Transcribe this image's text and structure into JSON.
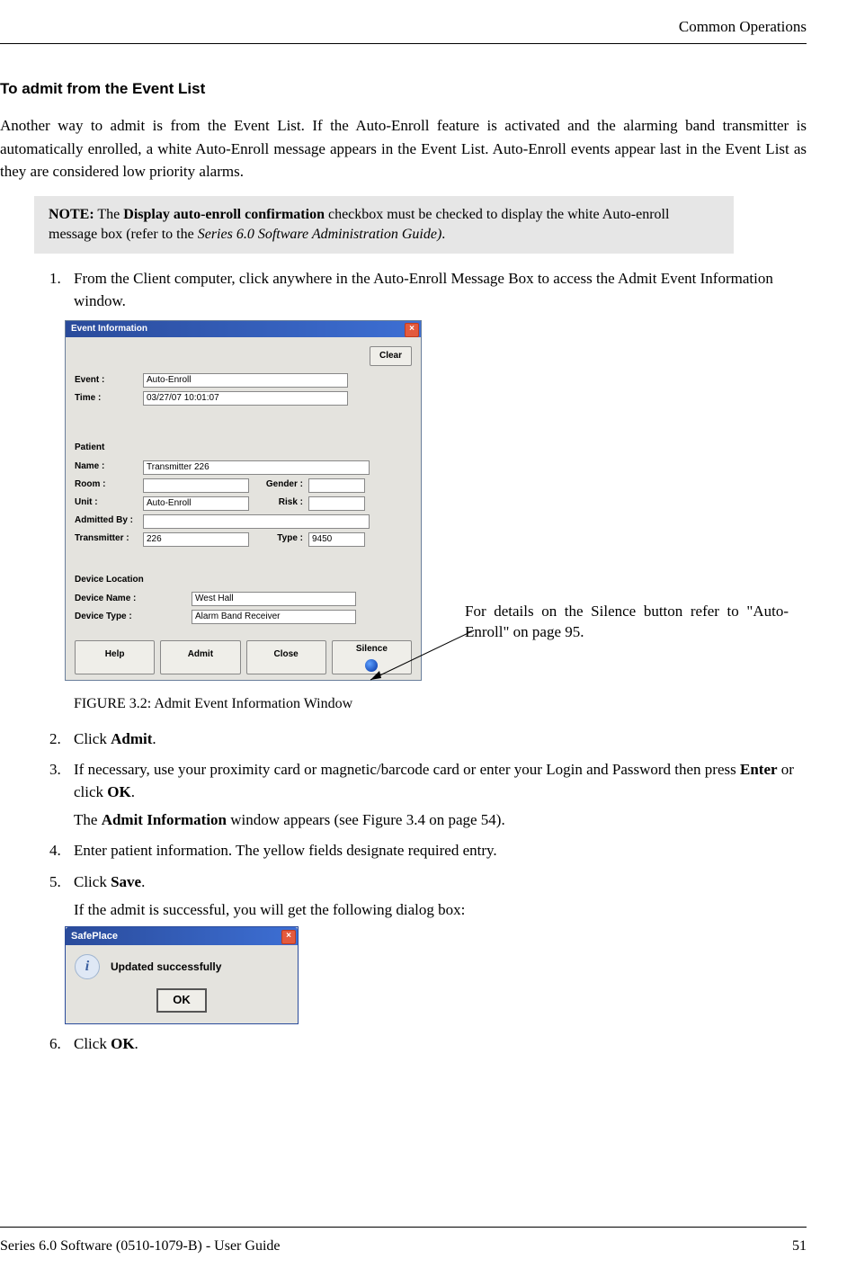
{
  "header": {
    "section": "Common Operations"
  },
  "heading": "To admit from the Event List",
  "intro": "Another way to admit is from the Event List. If the Auto-Enroll feature is activated and the alarming band transmitter is automatically enrolled, a white Auto-Enroll message appears in the Event List. Auto-Enroll events appear last in the Event List as they are considered low priority alarms.",
  "note": {
    "label": "NOTE:",
    "text_before": " The ",
    "bold1": "Display auto-enroll confirmation",
    "text_mid": " checkbox must be checked to display the white Auto-enroll message box (refer to the ",
    "italic1": "Series 6.0 Software Administration Guide)",
    "text_after": "."
  },
  "steps": {
    "s1": "From the Client computer, click anywhere in the Auto-Enroll Message Box to access the Admit Event Information window.",
    "s2_prefix": "Click ",
    "s2_bold": "Admit",
    "s2_suffix": ".",
    "s3_prefix": "If necessary, use your proximity card or magnetic/barcode card or enter your Login and Password then press ",
    "s3_bold1": "Enter",
    "s3_mid": " or click ",
    "s3_bold2": "OK",
    "s3_suffix": ".",
    "s3_sub_prefix": "The ",
    "s3_sub_bold": "Admit Information",
    "s3_sub_suffix": " window appears (see Figure 3.4 on page 54).",
    "s4": "Enter patient information. The yellow fields designate required entry.",
    "s5_prefix": "Click ",
    "s5_bold": "Save",
    "s5_suffix": ".",
    "s5_sub": "If the admit is successful, you will get the following dialog box:",
    "s6_prefix": "Click ",
    "s6_bold": "OK",
    "s6_suffix": "."
  },
  "event_dialog": {
    "title": "Event Information",
    "clear": "Clear",
    "labels": {
      "event": "Event :",
      "time": "Time :",
      "patient": "Patient",
      "name": "Name :",
      "room": "Room :",
      "gender": "Gender :",
      "unit": "Unit :",
      "risk": "Risk :",
      "admitted_by": "Admitted By :",
      "transmitter": "Transmitter :",
      "type": "Type :",
      "device_location": "Device Location",
      "device_name": "Device Name :",
      "device_type": "Device Type :"
    },
    "values": {
      "event": "Auto-Enroll",
      "time": "03/27/07 10:01:07",
      "name": "Transmitter   226",
      "room": "",
      "gender": "",
      "unit": "Auto-Enroll",
      "risk": "",
      "admitted_by": "",
      "transmitter": "226",
      "type": "9450",
      "device_name": "West Hall",
      "device_type": "Alarm Band Receiver"
    },
    "buttons": {
      "help": "Help",
      "admit": "Admit",
      "close": "Close",
      "silence": "Silence"
    }
  },
  "callout": "For details on the Silence button refer to \"Auto-Enroll\" on page 95.",
  "figure_caption": "FIGURE 3.2:    Admit Event Information Window",
  "safeplace": {
    "title": "SafePlace",
    "message": "Updated successfully",
    "ok": "OK"
  },
  "footer": {
    "left": "Series 6.0 Software (0510-1079-B) - User Guide",
    "page": "51"
  }
}
